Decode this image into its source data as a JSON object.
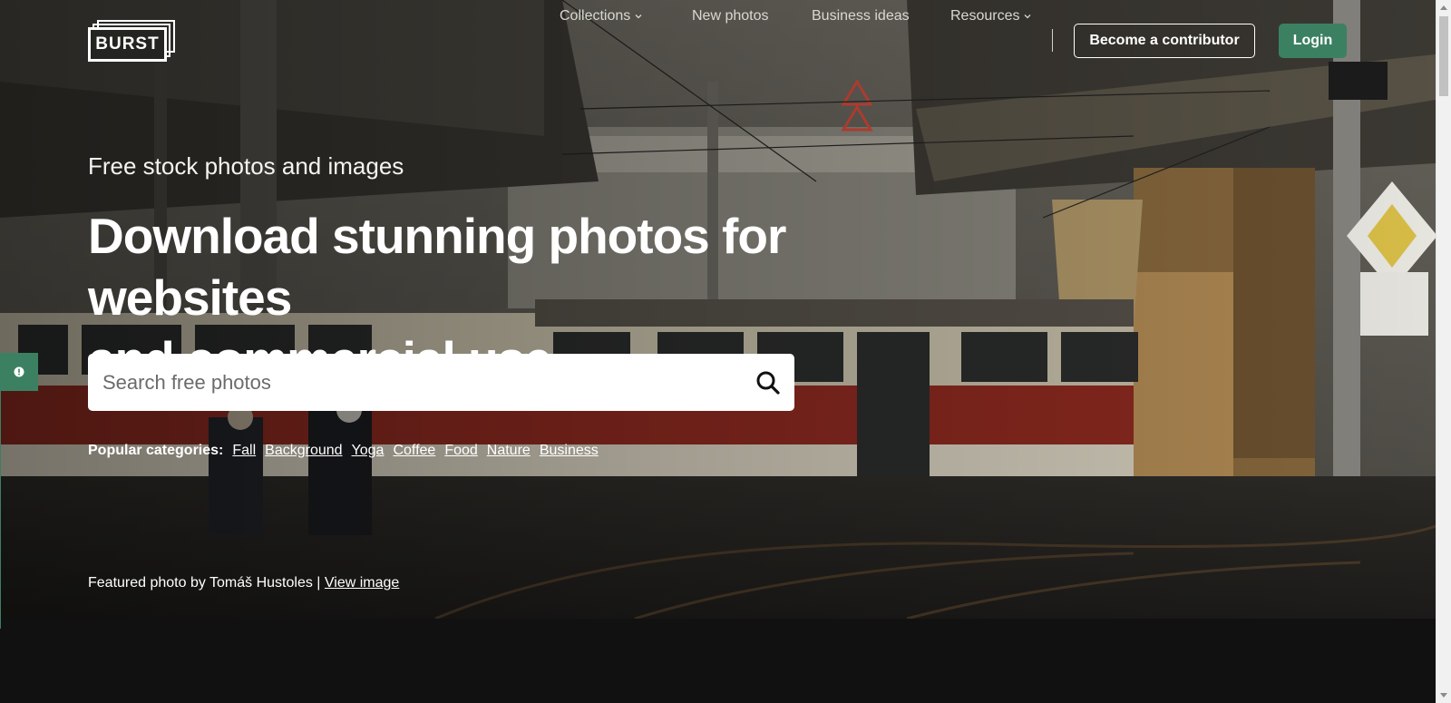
{
  "brand": {
    "logo_text": "BURST"
  },
  "nav": {
    "items": [
      {
        "label": "Collections",
        "has_dropdown": true
      },
      {
        "label": "New photos",
        "has_dropdown": false
      },
      {
        "label": "Business ideas",
        "has_dropdown": false
      },
      {
        "label": "Resources",
        "has_dropdown": true
      }
    ],
    "contributor_button": "Become a contributor",
    "login_button": "Login"
  },
  "hero": {
    "tagline": "Free stock photos and images",
    "headline_line1": "Download stunning photos for websites",
    "headline_line2": "and commercial use"
  },
  "search": {
    "placeholder": "Search free photos",
    "value": "",
    "icon": "search-icon"
  },
  "categories": {
    "label": "Popular categories:",
    "items": [
      "Fall",
      "Background",
      "Yoga",
      "Coffee",
      "Food",
      "Nature",
      "Business"
    ]
  },
  "credit": {
    "text": "Featured photo by Tomáš Hustoles |",
    "link": "View image"
  },
  "feedback": {
    "icon": "info-icon"
  },
  "colors": {
    "accent": "#3c8062",
    "page_background": "#111111",
    "text_light": "#ffffff"
  }
}
